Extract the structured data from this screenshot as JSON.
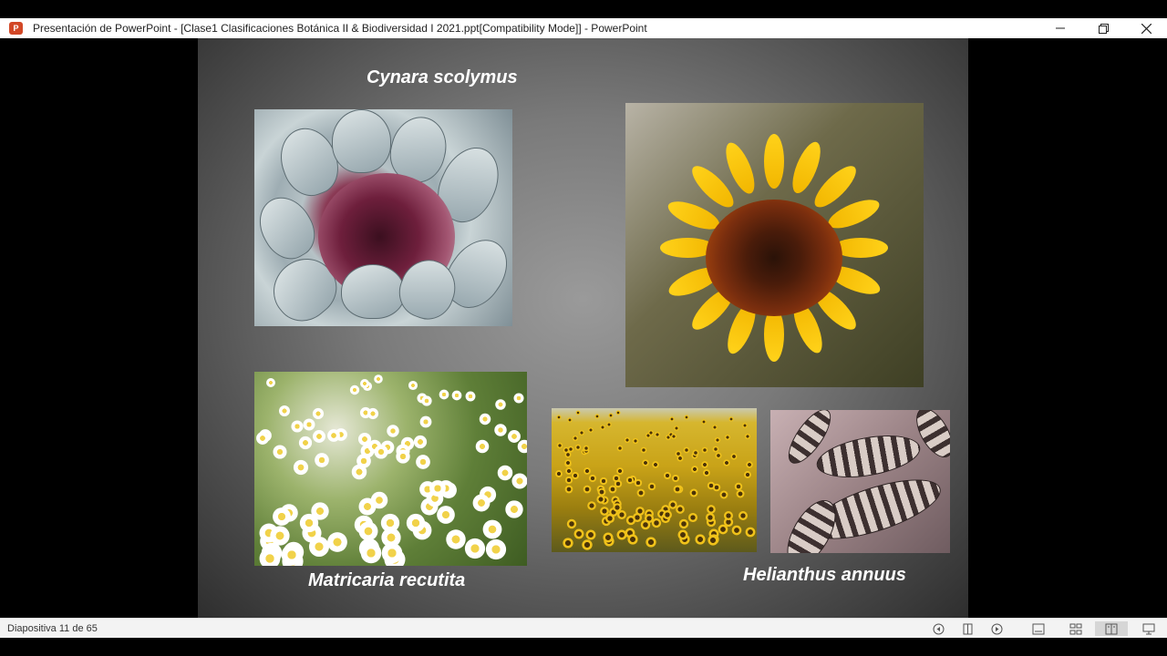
{
  "window": {
    "title": "Presentación de PowerPoint - [Clase1 Clasificaciones Botánica II & Biodiversidad I 2021.ppt[Compatibility Mode]] - PowerPoint",
    "app_icon_letter": "P",
    "app_icon": "powerpoint-icon",
    "minimize_icon": "minimize-icon",
    "restore_icon": "restore-icon",
    "close_icon": "close-icon"
  },
  "slide": {
    "captions": {
      "artichoke": "Cynara scolymus",
      "chamomile": "Matricaria recutita",
      "sunflower": "Helianthus annuus"
    },
    "photos": [
      "artichoke-photo",
      "sunflower-photo",
      "chamomile-field-photo",
      "sunflower-field-photo",
      "sunflower-seeds-photo"
    ]
  },
  "status_bar": {
    "slide_indicator": "Diapositiva 11 de 65",
    "buttons": [
      "previous-icon",
      "pause-icon",
      "next-icon",
      "notes-view-icon",
      "slide-sorter-icon",
      "reading-view-icon",
      "slideshow-icon"
    ],
    "colors": {
      "background": "#f3f3f3",
      "active": "#d6d6d6"
    }
  }
}
